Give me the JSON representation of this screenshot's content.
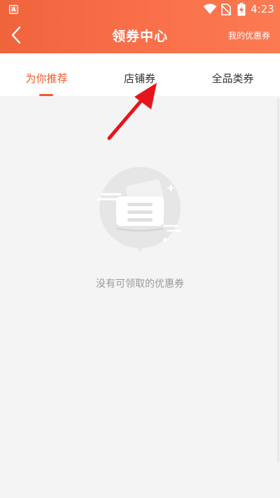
{
  "status_bar": {
    "app_icon_letter": "A",
    "time": "4:23",
    "icons": [
      "wifi-icon",
      "no-sim-icon",
      "battery-charging-icon"
    ]
  },
  "header": {
    "title": "领券中心",
    "right_link": "我的优惠券",
    "back_icon": "chevron-left-icon",
    "background_colors": [
      "#f0643c",
      "#fb7a52"
    ]
  },
  "tabs": [
    {
      "label": "为你推荐",
      "active": true
    },
    {
      "label": "店铺券",
      "active": false
    },
    {
      "label": "全品类券",
      "active": false
    }
  ],
  "empty_state": {
    "icon": "empty-coupon-icon",
    "message": "没有可领取的优惠券"
  },
  "annotation": {
    "icon": "red-arrow-icon",
    "color": "#e8141c"
  },
  "colors": {
    "accent": "#f05a2c",
    "background": "#f4f4f4"
  }
}
